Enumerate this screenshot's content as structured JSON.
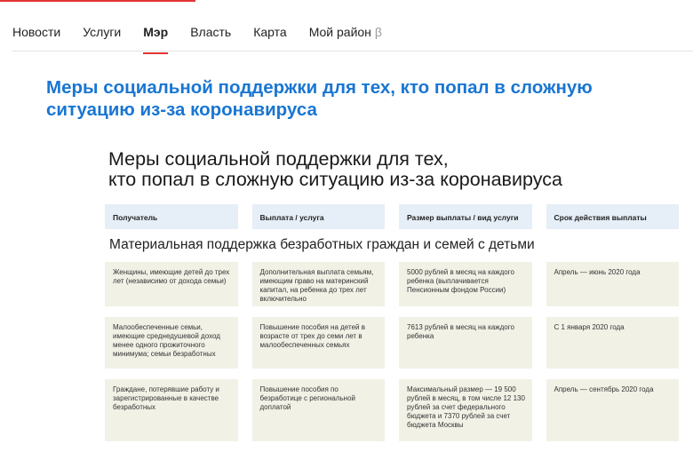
{
  "colors": {
    "accent": "#e03434",
    "link_blue": "#1976d2",
    "header_bg": "#e6eef7",
    "cell_bg": "#f2f1e6"
  },
  "nav": {
    "items": [
      {
        "label": "Новости"
      },
      {
        "label": "Услуги"
      },
      {
        "label": "Мэр"
      },
      {
        "label": "Власть"
      },
      {
        "label": "Карта"
      },
      {
        "label": "Мой район",
        "suffix": "β"
      }
    ],
    "active": "Мэр"
  },
  "page_title": "Меры социальной поддержки для тех, кто попал в сложную ситуацию из-за коронавируса",
  "infographic": {
    "title_line1": "Меры социальной поддержки для тех,",
    "title_line2": "кто попал в сложную ситуацию из-за коронавируса",
    "headers": [
      "Получатель",
      "Выплата / услуга",
      "Размер выплаты /  вид услуги",
      "Срок действия выплаты"
    ],
    "section_title": "Материальная поддержка безработных граждан и семей с детьми",
    "rows": [
      [
        "Женщины, имеющие детей до трех лет (независимо от дохода семьи)",
        "Дополнительная выплата семьям, имеющим право на материнский капитал, на ребенка до трех лет включительно",
        "5000 рублей в месяц на каждого ребенка (выплачивается Пенсионным фондом России)",
        "Апрель — июнь 2020 года"
      ],
      [
        "Малообеспеченные семьи, имеющие среднедушевой доход менее одного прожиточного минимума; семьи безработных",
        "Повышение пособия на детей в возрасте от трех до семи лет в малообеспеченных семьях",
        "7613 рублей в месяц на каждого ребенка",
        "С 1 января 2020 года"
      ],
      [
        "Граждане, потерявшие работу и зарегистрированные в качестве безработных",
        "Повышение пособия по безработице с региональной доплатой",
        "Максимальный размер — 19 500 рублей в месяц, в том числе 12 130 рублей за счет федерального бюджета и 7370 рублей за счет бюджета Москвы",
        "Апрель — сентябрь 2020 года"
      ]
    ]
  }
}
